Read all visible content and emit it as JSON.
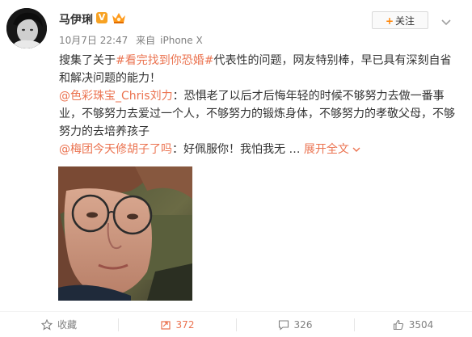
{
  "post": {
    "username": "马伊琍",
    "verified_badge": "V",
    "follow_label": "关注",
    "timestamp": "10月7日 22:47",
    "source_prefix": "来自",
    "source_device": "iPhone X",
    "text": {
      "part1": "搜集了关于",
      "hashtag": "#看完找到你恐婚#",
      "part2": "代表性的问题，网友特别棒，早已具有深刻自省和解决问题的能力！"
    },
    "quote1": {
      "mention": "@色彩珠宝_Chris刘力",
      "colon": "：",
      "text": "恐惧老了以后才后悔年轻的时候不够努力去做一番事业，不够努力去爱过一个人，不够努力的锻炼身体，不够努力的孝敬父母，不够努力的去培养孩子"
    },
    "quote2": {
      "mention": "@梅团今天修胡子了吗",
      "colon": "：",
      "text": "好佩服你！我怕我无 …",
      "expand_label": "展开全文"
    }
  },
  "actions": {
    "favorite": {
      "label": "收藏"
    },
    "repost": {
      "count": "372"
    },
    "comment": {
      "count": "326"
    },
    "like": {
      "count": "3504"
    }
  },
  "colors": {
    "link": "#eb7350",
    "meta": "#808080",
    "follow_plus": "#ff8200",
    "vip_badge": "#f7a223"
  },
  "icons": [
    "avatar",
    "verified-badge",
    "member-badge",
    "chevron-down-icon",
    "star-icon",
    "repost-icon",
    "comment-icon",
    "like-icon"
  ]
}
